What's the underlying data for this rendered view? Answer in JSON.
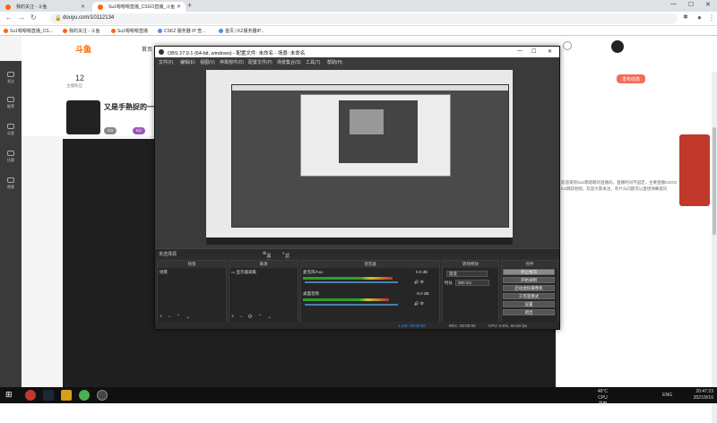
{
  "browser": {
    "tabs": [
      {
        "label": "我的关注 - 斗鱼"
      },
      {
        "label": "Su1嗯嗯嗯直播_CSGO直播_斗鱼"
      }
    ],
    "url": "douyu.com/10112134",
    "bookmarks": [
      "Su1嗯嗯嗯直播_CS...",
      "我的关注 - 斗鱼",
      "Su1嗯嗯嗯直播",
      "CSKZ 服务器 IP 查...",
      "首页 | KZ服务器IP..."
    ]
  },
  "site": {
    "logo": "斗鱼",
    "nav": [
      "首页"
    ],
    "counts": [
      {
        "value": "12",
        "label": "主播粉丝"
      }
    ],
    "room_title": "又是手熟捉的一天",
    "left_nav": [
      "关注",
      "推荐",
      "分类",
      "比赛",
      "视频"
    ],
    "right_col_text": "欢迎来到Su1嗯嗯嗯的直播间，直播时间不固定，主要直播CSGO KZ跳跃地图，欢迎大家关注，有什么问题可以直接弹幕提问",
    "right_badge": "发布动态"
  },
  "obs": {
    "title": "OBS 27.0.1 (64-bit, windows) - 配置文件: 未命名 - 场景: 未命名",
    "menu": [
      "文件(F)",
      "编辑(E)",
      "视图(V)",
      "停靠部件(D)",
      "配置文件(P)",
      "场景集合(S)",
      "工具(T)",
      "帮助(H)"
    ],
    "no_source": "未选择源",
    "props_btn": "属性",
    "filters_btn": "滤镜",
    "panels": {
      "scenes": {
        "header": "场景",
        "items": [
          "场景"
        ]
      },
      "sources": {
        "header": "来源",
        "items": [
          "显示器采集"
        ]
      },
      "mixer": {
        "header": "混音器",
        "channels": [
          {
            "name": "桌面音频",
            "db": "-0.0 dB"
          },
          {
            "name": "麦克风/Aux",
            "db": "0.0 dB"
          }
        ]
      },
      "transitions": {
        "header": "转场特效",
        "type": "渐变",
        "duration_label": "时长",
        "duration": "300 ms"
      },
      "controls": {
        "header": "控件",
        "buttons": [
          "停止推流",
          "开始录制",
          "启动虚拟摄像机",
          "工作室模式",
          "设置",
          "退出"
        ]
      }
    },
    "status": {
      "live": "LIVE: 00:00:00",
      "rec": "REC: 00:00:00",
      "cpu": "CPU: 0.0%, 60.00 fps"
    }
  },
  "taskbar": {
    "tray_temp": "46°C",
    "tray_cpu": "CPU温度",
    "lang": "ENG",
    "time": "20:47:23",
    "date": "2021/9/16"
  }
}
